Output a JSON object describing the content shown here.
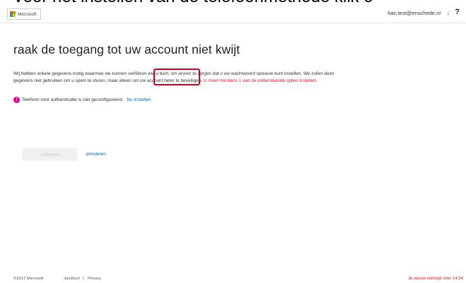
{
  "caption": "Voor het instellen van de telefoonmethode klik o",
  "header": {
    "logo_text": "Microsoft",
    "user_email": "han.test@enschede.nl",
    "divider": "|",
    "help_icon": "?"
  },
  "main": {
    "title": "raak de toegang tot uw account niet kwijt",
    "description_line1": "Wij hebben enkele gegevens nodig waarmee we kunnen verifiëren wie u bent, om ervoor te zorgen dat u uw wachtwoord opnieuw kunt instellen. We zullen deze",
    "description_line2": "gegevens niet gebruiken om u spam te sturen, maar alleen om uw account beter te beveiligen.",
    "description_warning": "U moet minstens 1 van de onderstaande opties instellen.",
    "warning_icon": "!",
    "warning_text": "Telefoon voor authenticatie is niet geconfigureerd.",
    "warning_link": "Nu instellen",
    "finish_button": "voltooien",
    "cancel_link": "annuleren"
  },
  "footer": {
    "copyright": "©2017 Microsoft",
    "legal_link": "Juridisch",
    "separator": "|",
    "privacy_link": "Privacy",
    "session_text": "Je sessie verloopt over 14:54"
  },
  "colors": {
    "link": "#0067b8",
    "warning_red": "#e81123",
    "highlight_box": "#d0021b",
    "warning_icon": "#e3008c"
  }
}
